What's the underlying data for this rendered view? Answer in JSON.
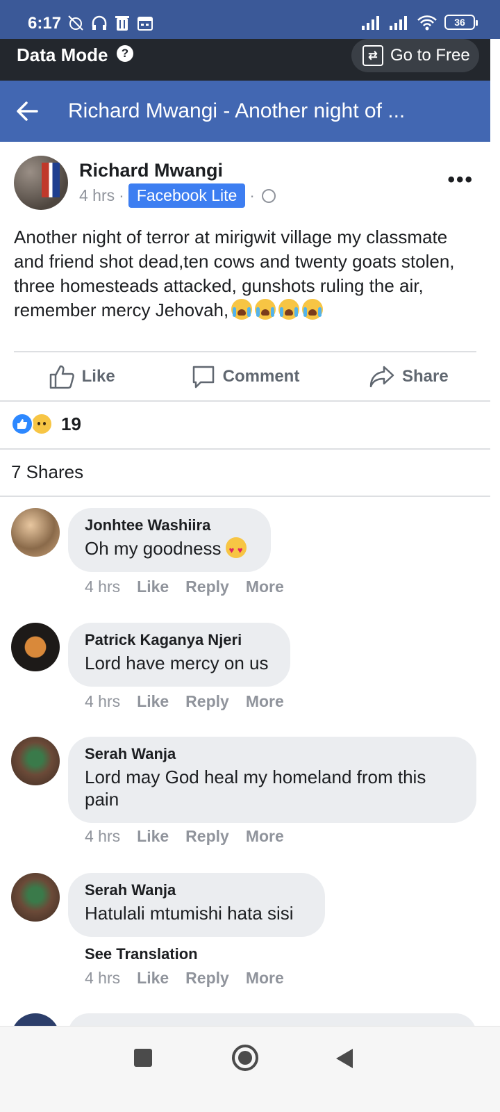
{
  "status_bar": {
    "time": "6:17",
    "battery": "36",
    "left_icons": [
      "alarm-off-icon",
      "headset-icon",
      "trash-icon",
      "calendar-icon"
    ],
    "right_icons": [
      "signal-icon",
      "signal-icon",
      "wifi-icon",
      "battery-icon"
    ]
  },
  "data_mode": {
    "label": "Data Mode",
    "help_symbol": "?",
    "go_free_label": "Go to Free"
  },
  "header": {
    "title": "Richard Mwangi - Another night of ..."
  },
  "post": {
    "author": "Richard Mwangi",
    "time": "4 hrs",
    "separator": "·",
    "source_badge": "Facebook Lite",
    "privacy_icon": "globe-icon",
    "text": "Another night of terror at mirigwit village my classmate and friend shot dead,ten cows and twenty goats stolen, three homesteads attacked, gunshots ruling the air, remember mercy Jehovah,",
    "emoji_count": 4,
    "more_label": "•••"
  },
  "actions": {
    "like": "Like",
    "comment": "Comment",
    "share": "Share"
  },
  "reactions": {
    "count": "19",
    "types": [
      "like",
      "sad"
    ]
  },
  "shares_label": "7 Shares",
  "comments": [
    {
      "name": "Jonhtee Washiira",
      "text": "Oh my goodness",
      "time": "4 hrs",
      "like": "Like",
      "reply": "Reply",
      "more": "More"
    },
    {
      "name": "Patrick Kaganya Njeri",
      "text": "Lord have mercy on us",
      "time": "4 hrs",
      "like": "Like",
      "reply": "Reply",
      "more": "More"
    },
    {
      "name": "Serah Wanja",
      "text": "Lord may God heal my homeland from this pain",
      "time": "4 hrs",
      "like": "Like",
      "reply": "Reply",
      "more": "More"
    },
    {
      "name": "Serah Wanja",
      "text": "Hatulali mtumishi hata sisi",
      "see_translation": "See Translation",
      "time": "4 hrs",
      "like": "Like",
      "reply": "Reply",
      "more": "More"
    }
  ],
  "colors": {
    "status_bar": "#3b5998",
    "header": "#4267b2",
    "data_bar": "#23272d",
    "badge": "#3d7ef1",
    "bubble": "#ebedf0"
  }
}
